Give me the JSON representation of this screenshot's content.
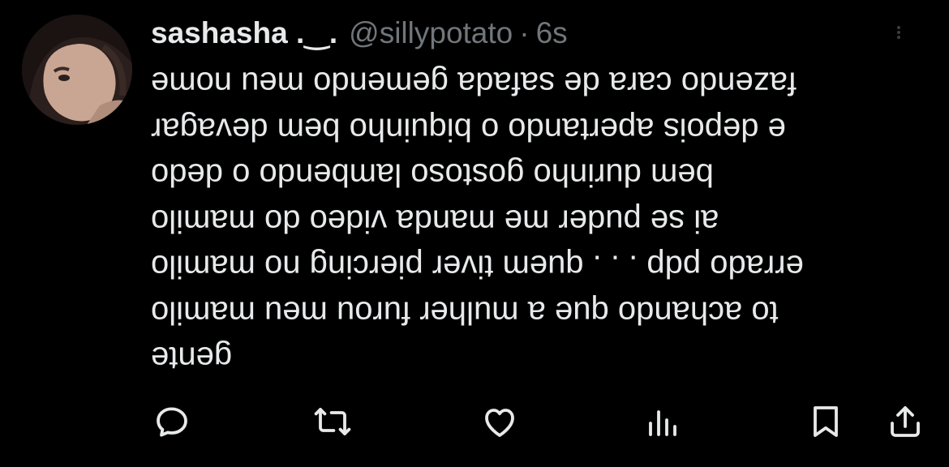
{
  "tweet": {
    "display_name": "sashasha .‿.",
    "handle": "@sillypotato",
    "separator": "·",
    "time": "6s",
    "lines": [
      "fazendo cara de safada gemendo meu nome",
      "e depois apertando o biquinho bem devagar",
      "bem durinho gostoso lambendo o dedo",
      "ai se puder me manda video do mamilo",
      "errado pdp . . . quem tiver piercing no mamilo",
      "to achando que a mulher furou meu mamilo",
      "gente"
    ]
  },
  "actions": {
    "icons": [
      "reply-icon",
      "retweet-icon",
      "like-icon",
      "views-icon",
      "bookmark-icon",
      "share-icon"
    ]
  },
  "colors": {
    "background": "#000000",
    "primary_text": "#e7e9ea",
    "secondary_text": "#71767b"
  }
}
